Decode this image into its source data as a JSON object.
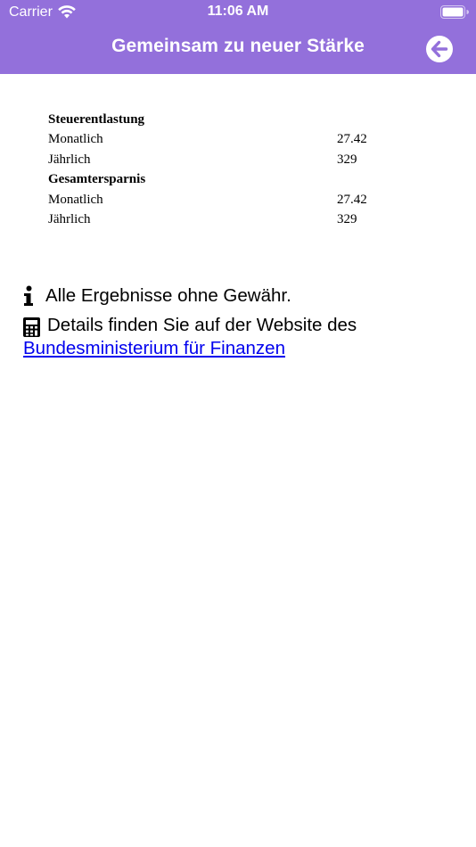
{
  "status_bar": {
    "carrier": "Carrier",
    "time": "11:06 AM"
  },
  "nav": {
    "title": "Gemeinsam zu neuer Stärke",
    "back_icon": "arrow-left-circle-icon"
  },
  "results": {
    "sections": [
      {
        "title": "Steuerentlastung",
        "rows": [
          {
            "label": "Monatlich",
            "value": "27.42"
          },
          {
            "label": "Jährlich",
            "value": "329"
          }
        ]
      },
      {
        "title": "Gesamtersparnis",
        "rows": [
          {
            "label": "Monatlich",
            "value": "27.42"
          },
          {
            "label": "Jährlich",
            "value": "329"
          }
        ]
      }
    ]
  },
  "info": {
    "disclaimer": "Alle Ergebnisse ohne Gewähr.",
    "details_text": "Details finden Sie auf der Website des",
    "link_text": "Bundesministerium für Finanzen"
  },
  "colors": {
    "header_bg": "#9370db",
    "link": "#0000ee"
  }
}
